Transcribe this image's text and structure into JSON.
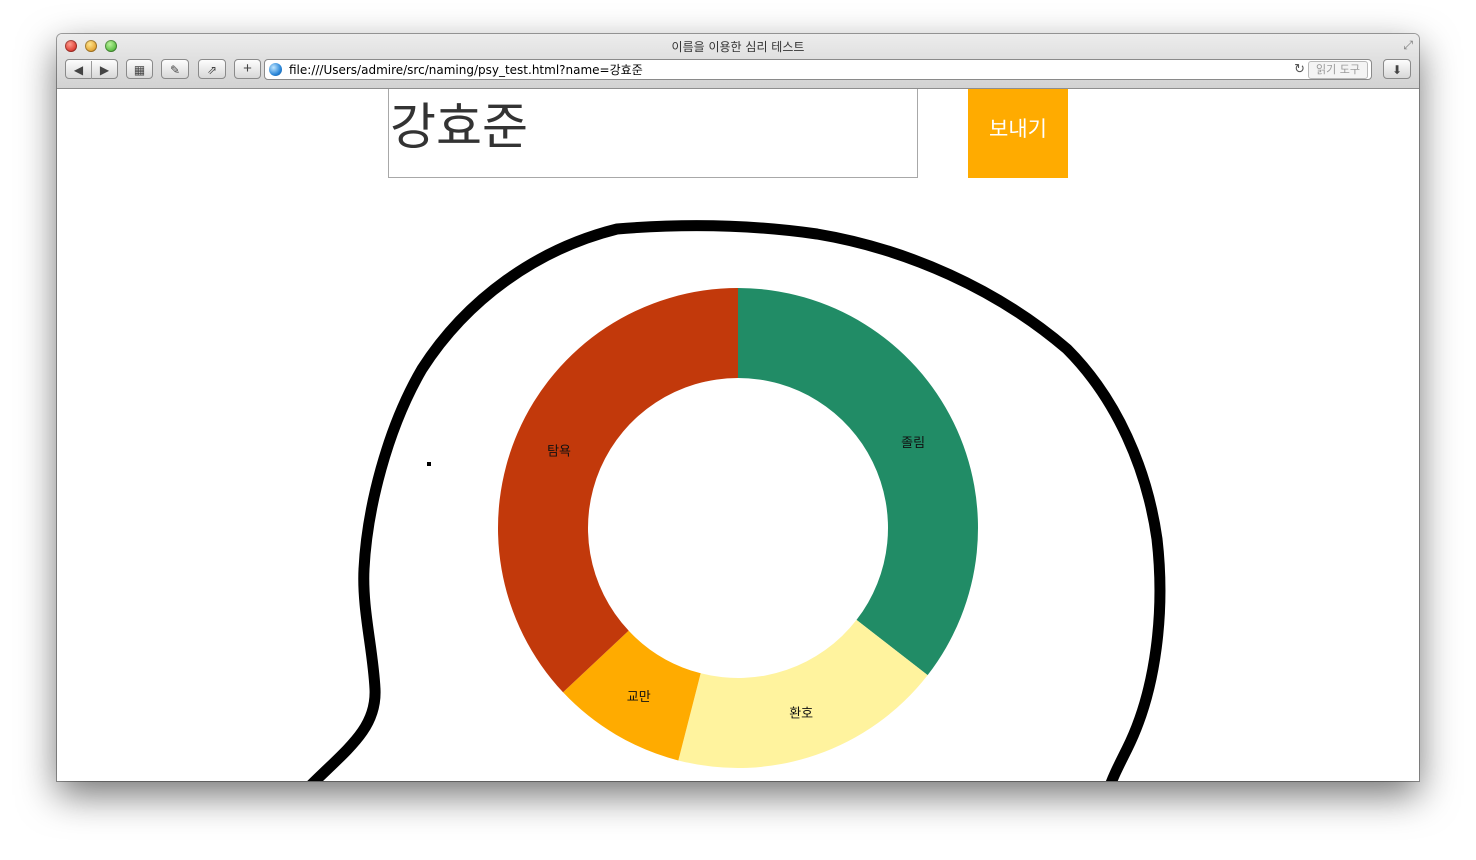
{
  "browser": {
    "window_title": "이름을 이용한 심리 테스트",
    "url": "file:///Users/admire/src/naming/psy_test.html?name=강효준",
    "reader_label": "읽기 도구",
    "icons": {
      "back": "back-arrow-icon",
      "forward": "forward-arrow-icon",
      "top_sites": "top-sites-icon",
      "tools": "wrench-icon",
      "share": "share-icon",
      "add": "plus-icon",
      "site": "globe-icon",
      "reload": "reload-icon",
      "download": "download-icon",
      "fullscreen": "fullscreen-icon"
    }
  },
  "form": {
    "name_value": "강효준",
    "send_label": "보내기",
    "send_color": "#ffab00"
  },
  "chart_data": {
    "type": "pie",
    "donut": true,
    "start": "top",
    "direction": "clockwise",
    "slices": [
      {
        "label": "졸림",
        "value": 35.5,
        "color": "#218c66"
      },
      {
        "label": "환호",
        "value": 18.5,
        "color": "#fff39e"
      },
      {
        "label": "교만",
        "value": 9.0,
        "color": "#ffab00"
      },
      {
        "label": "탐욕",
        "value": 37.0,
        "color": "#c2390b"
      }
    ]
  }
}
